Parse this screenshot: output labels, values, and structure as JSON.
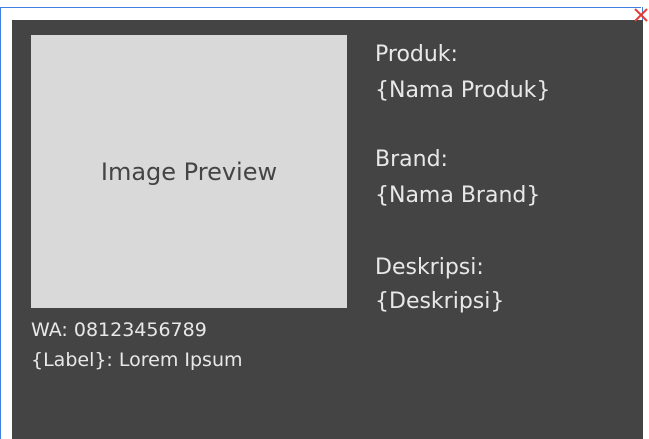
{
  "card": {
    "image_placeholder": "Image Preview",
    "product_label": "Produk:",
    "product_value": "{Nama Produk}",
    "brand_label": "Brand:",
    "brand_value": "{Nama Brand}",
    "description_label": "Deskripsi:",
    "description_value": "{Deskripsi}",
    "whatsapp": "WA: 08123456789",
    "custom_label": "{Label}: Lorem Ipsum"
  },
  "colors": {
    "card_background": "#444444",
    "image_background": "#d9d9d9",
    "text": "#e8e8e8",
    "selection": "#3f80e0",
    "close": "#e53935"
  },
  "icons": {
    "close": "close-icon"
  }
}
